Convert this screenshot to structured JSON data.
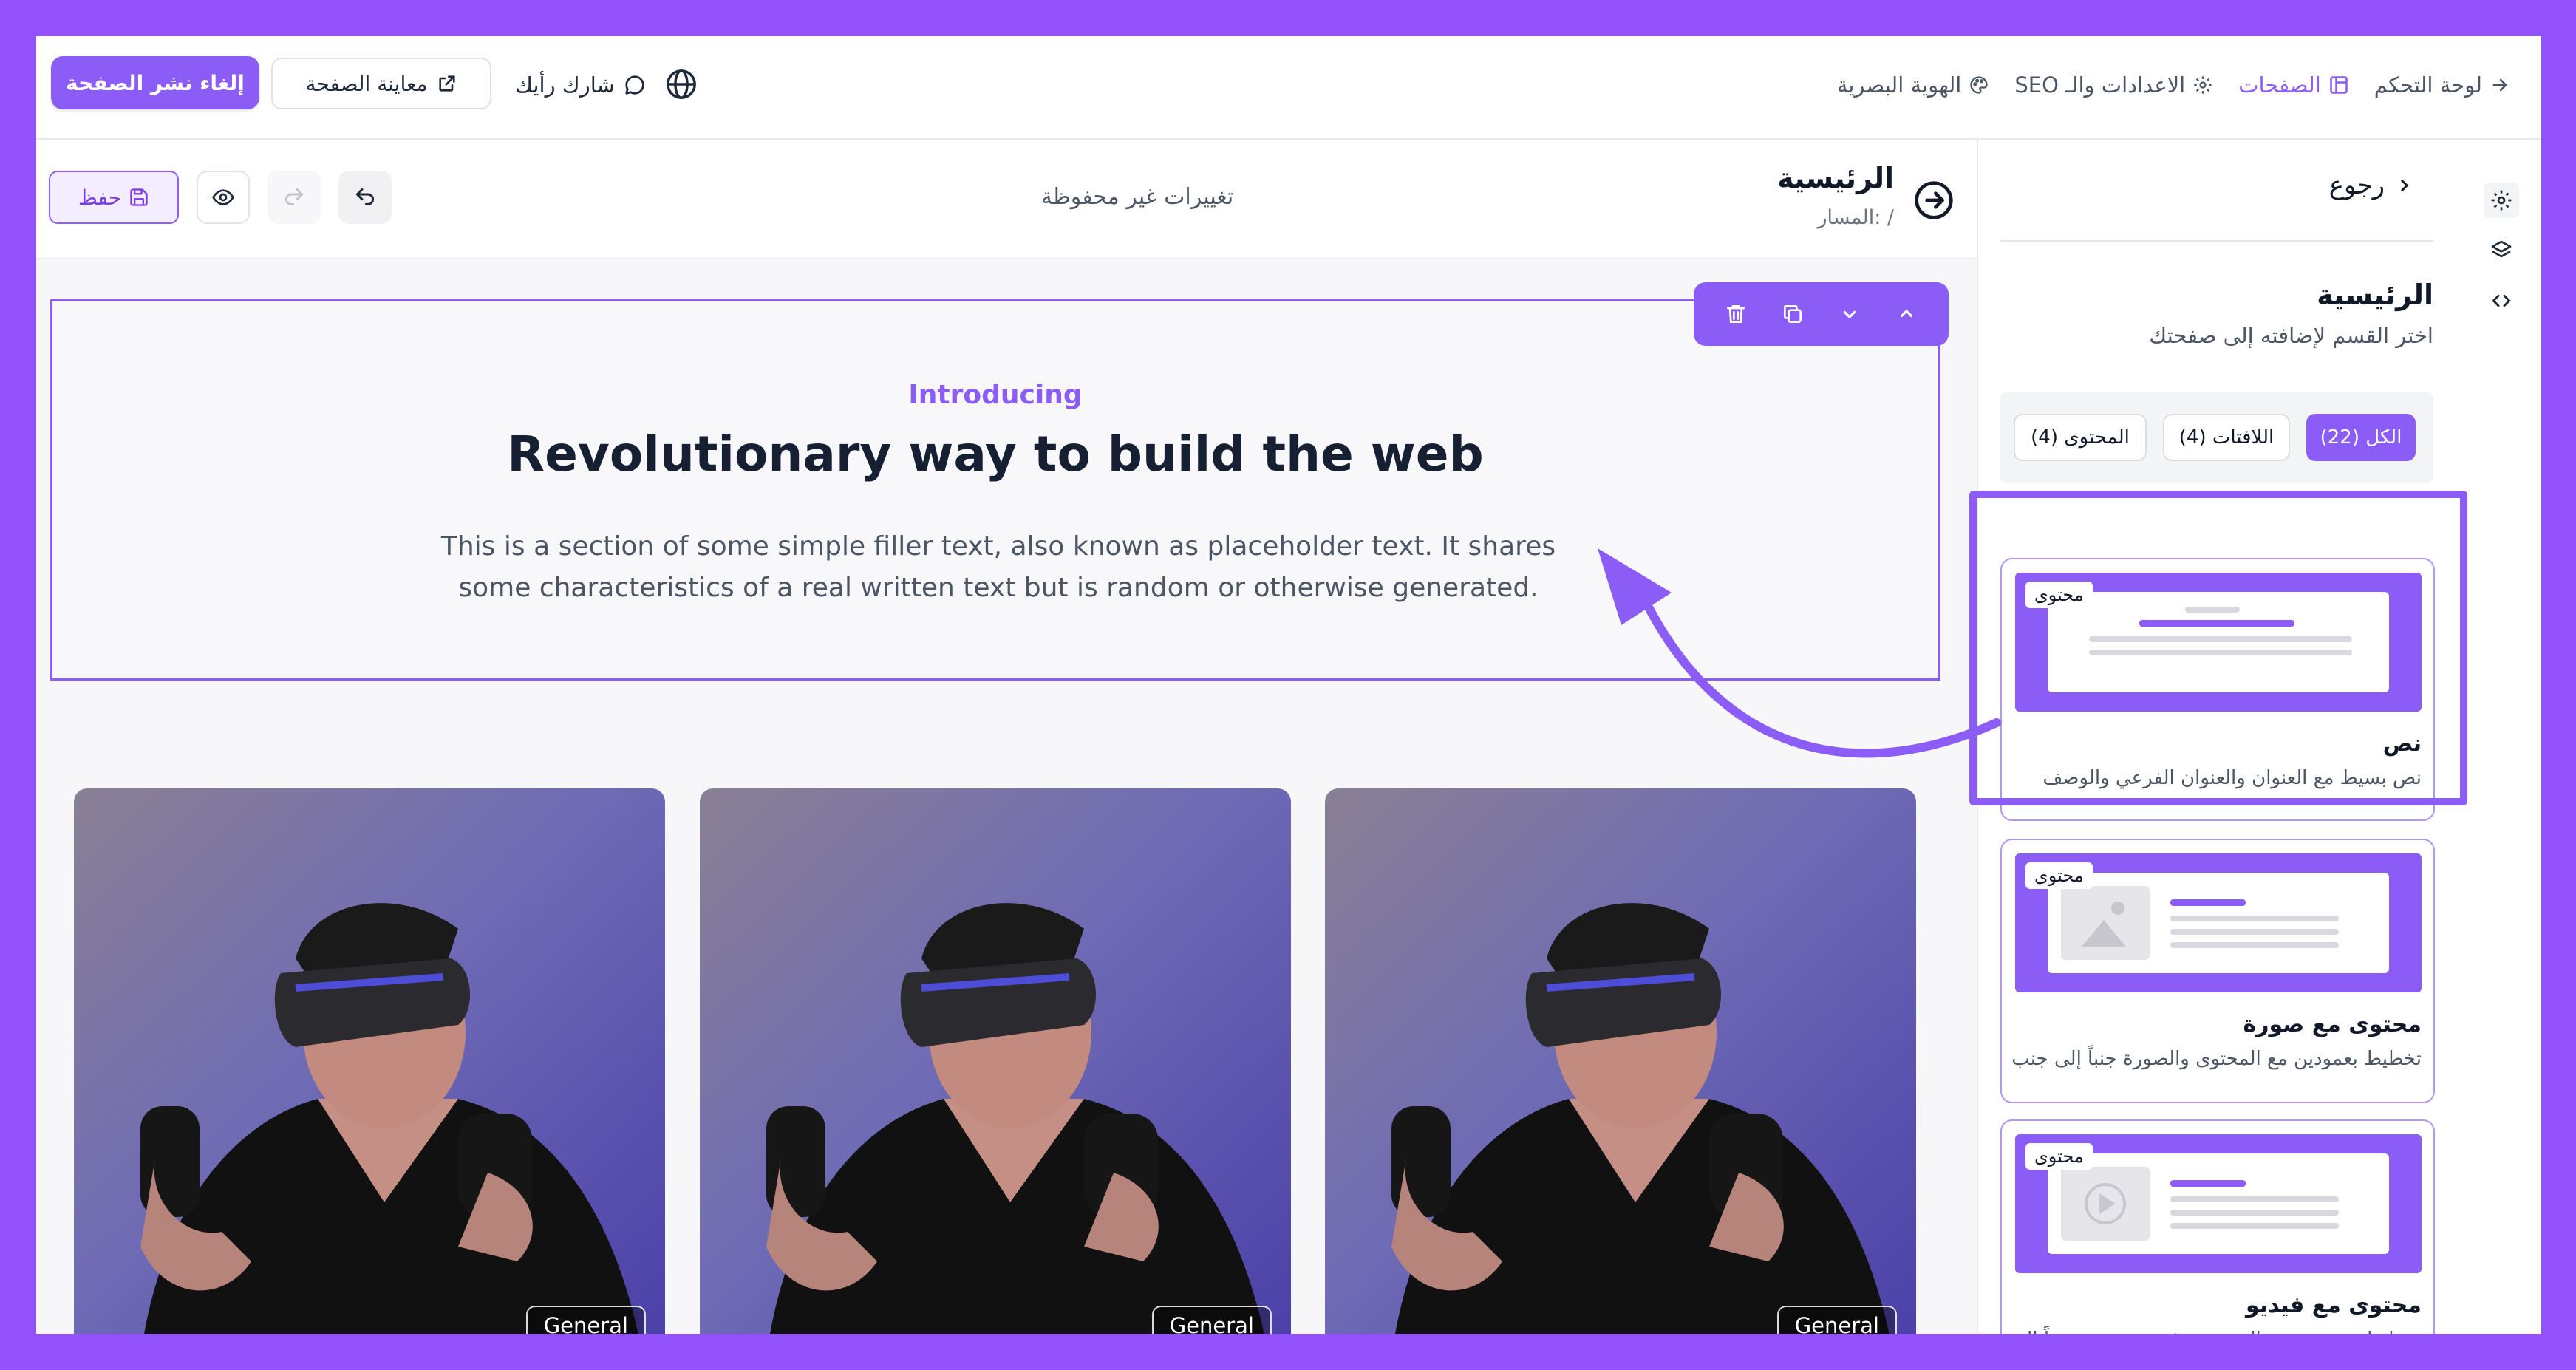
{
  "topbar": {
    "unpublish_label": "إلغاء نشر الصفحة",
    "preview_label": "معاينة الصفحة",
    "feedback_label": "شارك رأيك",
    "nav": [
      {
        "label": "لوحة التحكم",
        "icon": "arrow-right-icon"
      },
      {
        "label": "الصفحات",
        "icon": "layout-icon",
        "active": true
      },
      {
        "label": "الاعدادات والـ SEO",
        "icon": "gear-icon"
      },
      {
        "label": "الهوية البصرية",
        "icon": "palette-icon"
      }
    ]
  },
  "editor": {
    "save_label": "حفظ",
    "unsaved_text": "تغييرات غير محفوظة",
    "page_title": "الرئيسية",
    "page_path": "المسار: /"
  },
  "hero": {
    "kicker": "Introducing",
    "headline": "Revolutionary way to build the web",
    "description": "This is a section of some simple filler text, also known as placeholder text. It shares some characteristics of a real written text but is random or otherwise generated."
  },
  "gallery": {
    "cards": [
      {
        "badge": "General"
      },
      {
        "badge": "General"
      },
      {
        "badge": "General"
      }
    ]
  },
  "sidebar": {
    "back_label": "رجوع",
    "title": "الرئيسية",
    "subtitle": "اختر القسم لإضافته إلى صفحتك",
    "filters": [
      {
        "label": "الكل (22)",
        "active": true
      },
      {
        "label": "اللافتات (4)"
      },
      {
        "label": "المحتوى (4)"
      }
    ],
    "sections": [
      {
        "tag": "محتوى",
        "name": "نص",
        "description": "نص بسيط مع العنوان والعنوان الفرعي والوصف"
      },
      {
        "tag": "محتوى",
        "name": "محتوى مع صورة",
        "description": "تخطيط بعمودين مع المحتوى والصورة جنباً إلى جنب"
      },
      {
        "tag": "محتوى",
        "name": "محتوى مع فيديو",
        "description": "تخطيط بعمودين مع المحتوى وفيديو يوتيوب جنباً إلى جنب"
      }
    ]
  },
  "colors": {
    "accent": "#8b5cf6",
    "background_frame": "#9351fc"
  }
}
